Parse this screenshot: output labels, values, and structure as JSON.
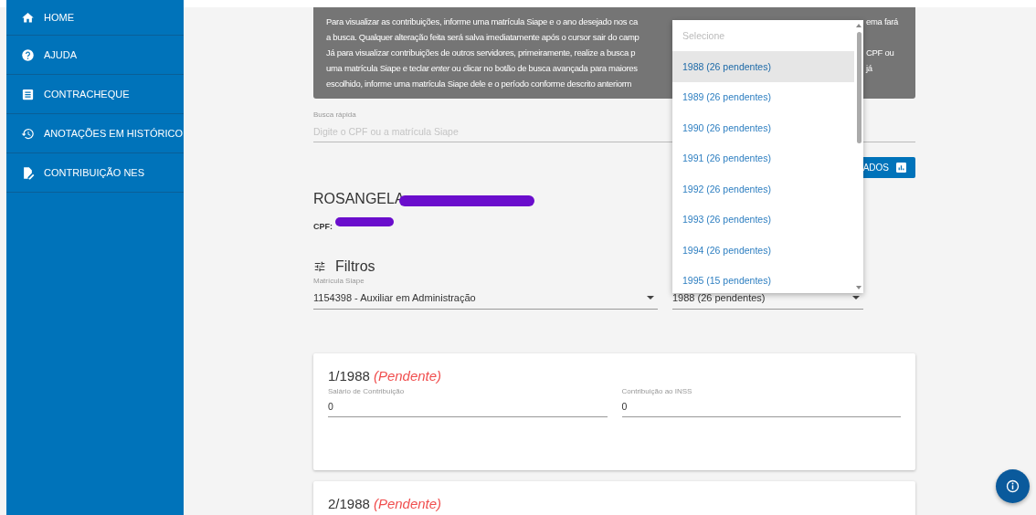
{
  "sidebar": {
    "items": [
      {
        "label": "HOME"
      },
      {
        "label": "AJUDA"
      },
      {
        "label": "CONTRACHEQUE"
      },
      {
        "label": "ANOTAÇÕES EM HISTÓRICO"
      },
      {
        "label": "CONTRIBUIÇÃO NES"
      }
    ]
  },
  "info_box": {
    "lines": [
      {
        "left": "Para visualizar as contribuições, informe uma matrícula Siape e o ano desejado nos ca",
        "right": "ema fará"
      },
      {
        "left": "a busca. Qualquer alteração feita será salva imediatamente após o cursor sair do camp"
      },
      {
        "left": "Já para visualizar contribuições de outros servidores, primeiramente, realize a busca p",
        "right": "CPF ou"
      },
      {
        "left": "uma matrícula Siape e teclar *enter* ou clicar no botão de busca avançada para maiores",
        "right": "já"
      },
      {
        "left": "escolhido, informe uma matrícula Siape dele e o período conforme descrito anteriorm"
      }
    ]
  },
  "quick_search": {
    "label": "Busca rápida",
    "placeholder": "Digite o CPF ou a matrícula Siape"
  },
  "advanced_button": {
    "label": "ADOS"
  },
  "person": {
    "name": "ROSANGELA",
    "cpf_label": "CPF:",
    "redacted": true
  },
  "filters": {
    "title": "Filtros",
    "matricula": {
      "label": "Matrícula Siape",
      "value": "1154398 - Auxiliar em Administração"
    },
    "year": {
      "value": "1988 (26 pendentes)"
    }
  },
  "year_dropdown": {
    "placeholder": "Selecione",
    "options": [
      {
        "label": "1988 (26 pendentes)",
        "selected": true
      },
      {
        "label": "1989 (26 pendentes)",
        "selected": false
      },
      {
        "label": "1990 (26 pendentes)",
        "selected": false
      },
      {
        "label": "1991 (26 pendentes)",
        "selected": false
      },
      {
        "label": "1992 (26 pendentes)",
        "selected": false
      },
      {
        "label": "1993 (26 pendentes)",
        "selected": false
      },
      {
        "label": "1994 (26 pendentes)",
        "selected": false
      },
      {
        "label": "1995 (15 pendentes)",
        "selected": false
      }
    ]
  },
  "cards": [
    {
      "period": "1/1988",
      "status": "(Pendente)",
      "fields": [
        {
          "label": "Salário de Contribuição",
          "value": "0"
        },
        {
          "label": "Contribuição ao INSS",
          "value": "0"
        }
      ]
    },
    {
      "period": "2/1988",
      "status": "(Pendente)"
    }
  ]
}
